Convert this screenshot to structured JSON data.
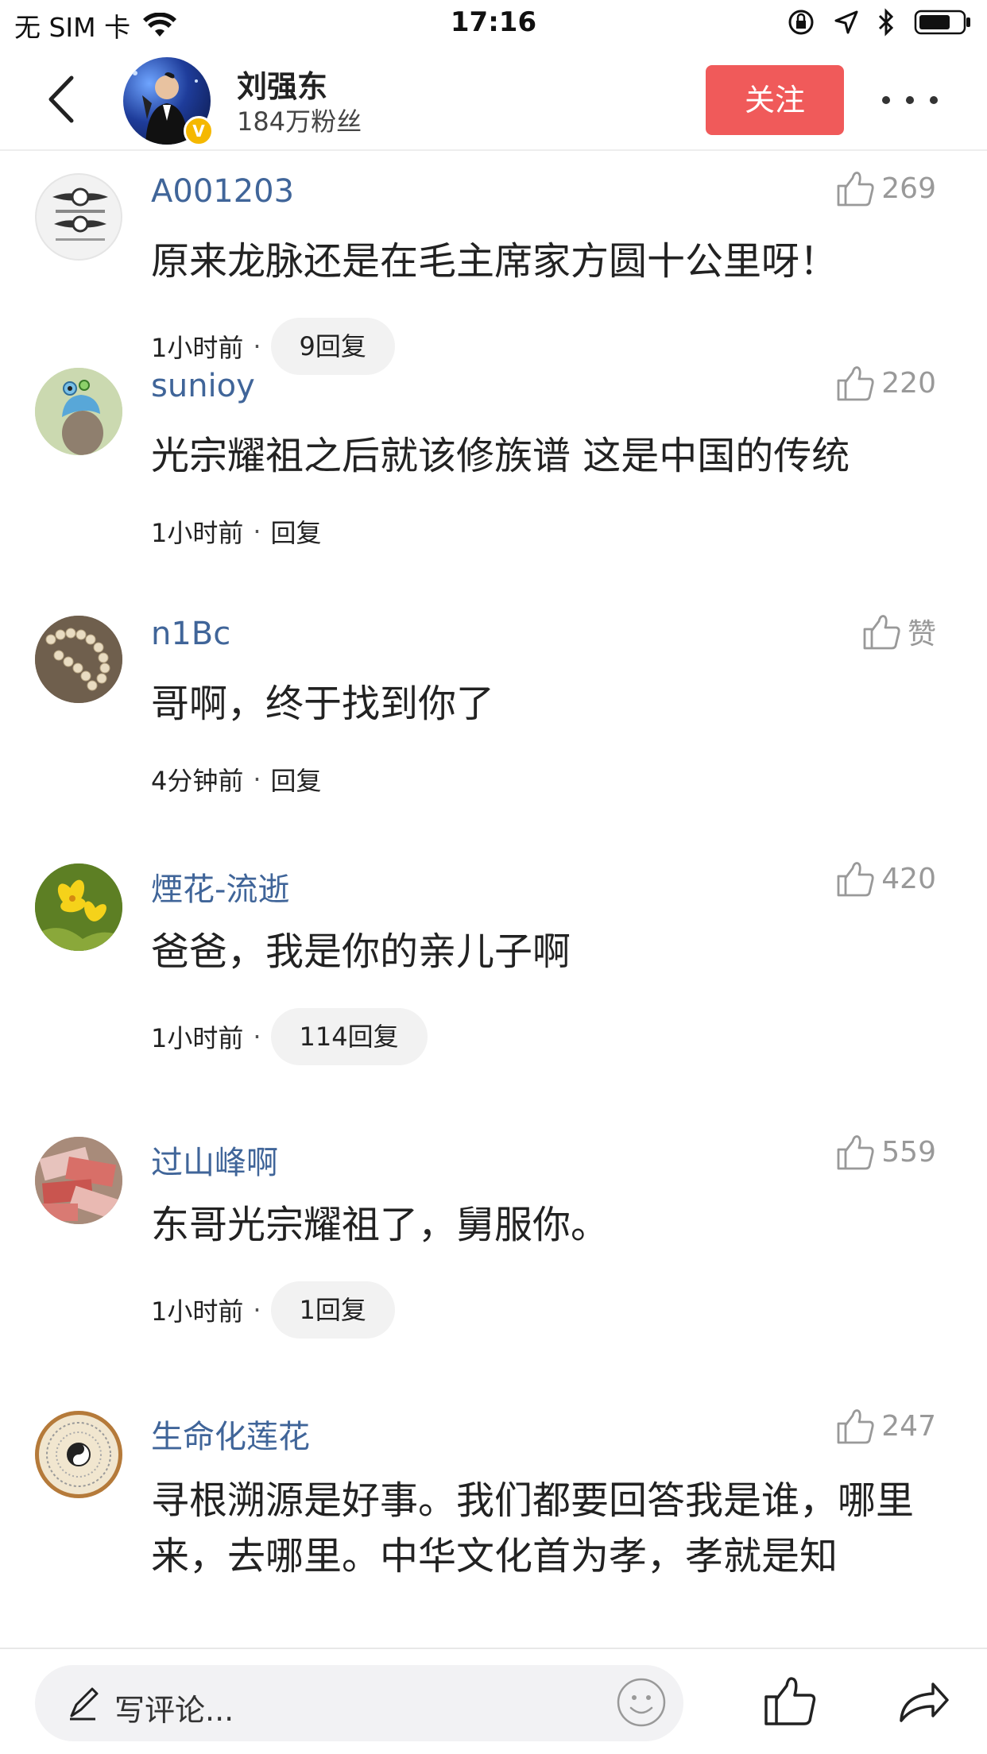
{
  "status_bar": {
    "carrier": "无 SIM 卡",
    "time": "17:16"
  },
  "header": {
    "author_name": "刘强东",
    "fans": "184万粉丝",
    "follow_label": "关注",
    "verified_mark": "V"
  },
  "comments": [
    {
      "user": "A001203",
      "text": "原来龙脉还是在毛主席家方圆十公里呀！",
      "time": "1小时前",
      "separator": "·",
      "reply": "9回复",
      "reply_pill": true,
      "likes": "269"
    },
    {
      "user": "sunioy",
      "text": "光宗耀祖之后就该修族谱 这是中国的传统",
      "time": "1小时前",
      "separator": "·",
      "reply": "回复",
      "reply_pill": false,
      "likes": "220"
    },
    {
      "user": "n1Bc",
      "text": "哥啊，终于找到你了",
      "time": "4分钟前",
      "separator": "·",
      "reply": "回复",
      "reply_pill": false,
      "likes": "赞"
    },
    {
      "user": "煙花-流逝",
      "text": "爸爸，我是你的亲儿子啊",
      "time": "1小时前",
      "separator": "·",
      "reply": "114回复",
      "reply_pill": true,
      "likes": "420"
    },
    {
      "user": "过山峰啊",
      "text": "东哥光宗耀祖了，舅服你。",
      "time": "1小时前",
      "separator": "·",
      "reply": "1回复",
      "reply_pill": true,
      "likes": "559"
    },
    {
      "user": "生命化莲花",
      "text": "寻根溯源是好事。我们都要回答我是谁，哪里来，去哪里。中华文化首为孝，孝就是知",
      "time": "",
      "separator": "",
      "reply": "",
      "reply_pill": false,
      "likes": "247"
    }
  ],
  "bottom_bar": {
    "input_placeholder": "写评论..."
  },
  "icons": {
    "wifi": "wifi-icon",
    "lock_rotation": "rotation-lock-icon",
    "location": "location-icon",
    "bluetooth": "bluetooth-icon",
    "battery": "battery-icon",
    "back": "back-arrow-icon",
    "more": "more-dots-icon",
    "like": "thumbs-up-icon",
    "pen": "pen-icon",
    "emoji": "smiley-icon",
    "share": "share-arrow-icon"
  },
  "colors": {
    "follow_button": "#f05a5a",
    "username": "#406599",
    "like_gray": "#999999",
    "verified": "#f5b800"
  }
}
